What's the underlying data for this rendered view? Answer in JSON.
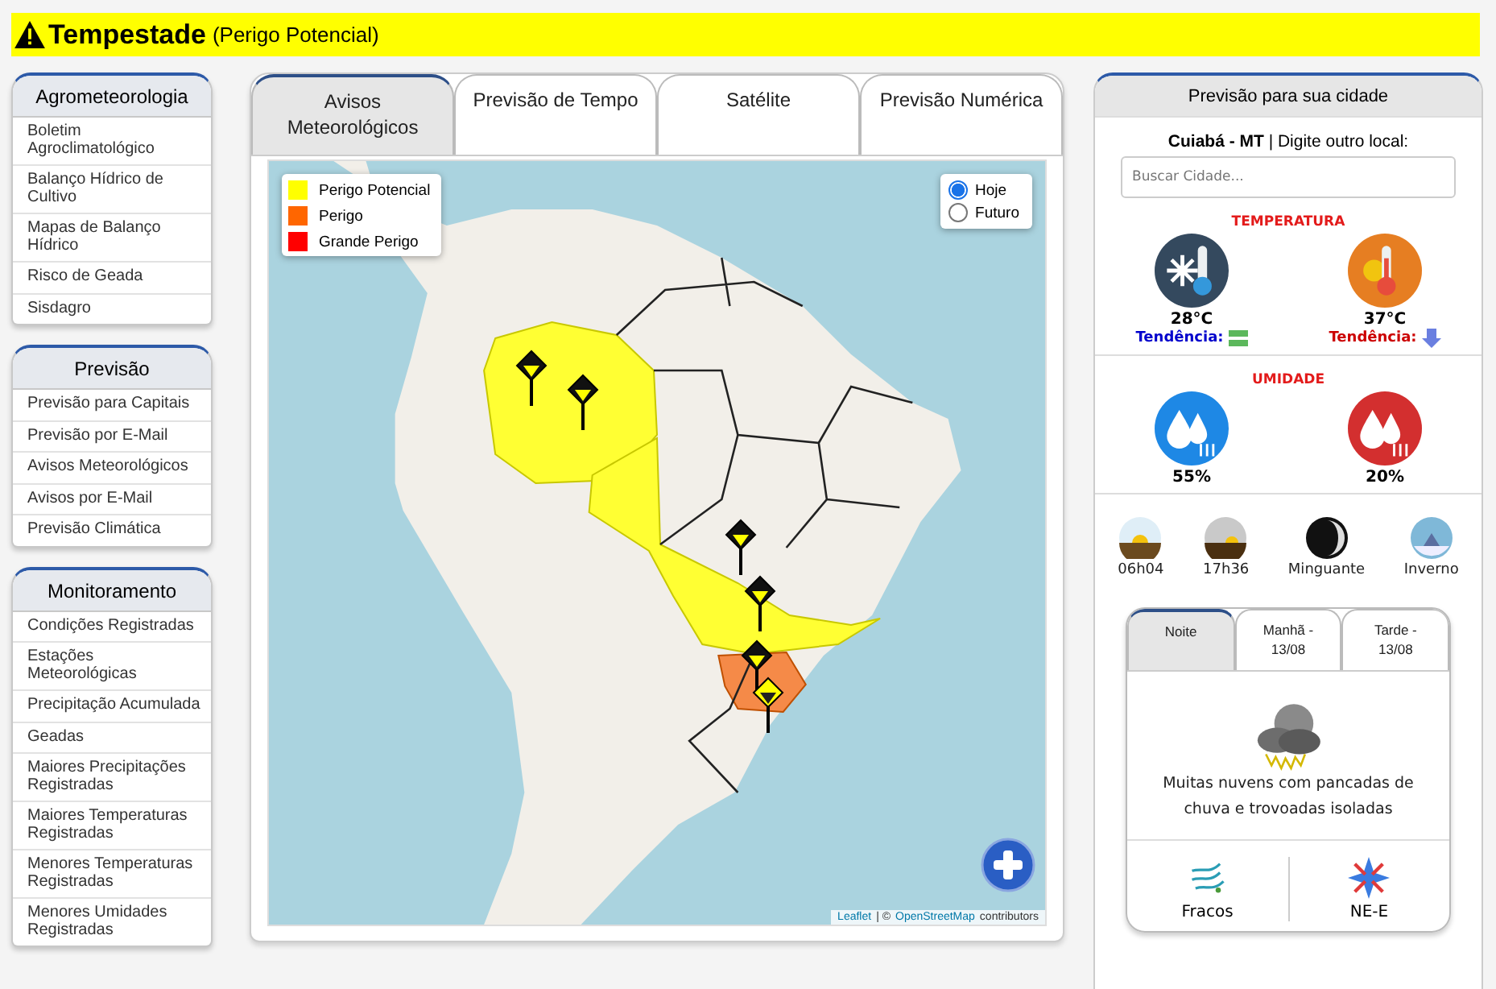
{
  "banner": {
    "title": "Tempestade",
    "subtitle": "(Perigo Potencial)"
  },
  "sidebar": [
    {
      "title": "Agrometeorologia",
      "items": [
        "Boletim Agroclimatológico",
        "Balanço Hídrico de Cultivo",
        "Mapas de Balanço Hídrico",
        "Risco de Geada",
        "Sisdagro"
      ]
    },
    {
      "title": "Previsão",
      "items": [
        "Previsão para Capitais",
        "Previsão por E-Mail",
        "Avisos Meteorológicos",
        "Avisos por E-Mail",
        "Previsão Climática"
      ]
    },
    {
      "title": "Monitoramento",
      "items": [
        "Condições Registradas",
        "Estações Meteorológicas",
        "Precipitação Acumulada",
        "Geadas",
        "Maiores Precipitações Registradas",
        "Maiores Temperaturas Registradas",
        "Menores Temperaturas Registradas",
        "Menores Umidades Registradas"
      ]
    }
  ],
  "tabs": [
    {
      "label": "Avisos Meteorológicos",
      "selected": true
    },
    {
      "label": "Previsão de Tempo",
      "selected": false
    },
    {
      "label": "Satélite",
      "selected": false
    },
    {
      "label": "Previsão Numérica",
      "selected": false
    }
  ],
  "map": {
    "legend": [
      {
        "label": "Perigo Potencial",
        "color": "#ffff00"
      },
      {
        "label": "Perigo",
        "color": "#ff6600"
      },
      {
        "label": "Grande Perigo",
        "color": "#ff0000"
      }
    ],
    "period_options": [
      {
        "label": "Hoje",
        "selected": true
      },
      {
        "label": "Futuro",
        "selected": false
      }
    ],
    "attribution": {
      "link_1": "Leaflet",
      "middle": "| ©",
      "link_2": "OpenStreetMap",
      "end": "contributors"
    }
  },
  "city_panel": {
    "title": "Previsão para sua cidade",
    "location": "**Cuiabá - MT** | Digite outro local:",
    "search": {
      "placeholder": "Buscar Cidade..."
    },
    "temperature": {
      "heading": "TEMPERATURA",
      "readings": [
        {
          "kind": "min",
          "value": "28°C",
          "trend_label": "Tendência:",
          "trend_icon": {
            "kind": "steady"
          },
          "color": "#0000cc"
        },
        {
          "kind": "max",
          "value": "37°C",
          "trend_label": "Tendência:",
          "trend_icon": {
            "kind": "down"
          },
          "color": "#cc0000"
        }
      ]
    },
    "humidity": {
      "heading": "UMIDADE",
      "readings": [
        {
          "kind": "max",
          "value": "55%"
        },
        {
          "kind": "min",
          "value": "20%"
        }
      ]
    },
    "astro": [
      {
        "kind": "sunrise",
        "label": "06h04"
      },
      {
        "kind": "sunset",
        "label": "17h36"
      },
      {
        "kind": "moon",
        "label": "Minguante"
      },
      {
        "kind": "season",
        "label": "Inverno"
      }
    ],
    "periods": [
      {
        "label": "Noite",
        "selected": true
      },
      {
        "label": "Manhã - 13/08",
        "selected": false
      },
      {
        "label": "Tarde - 13/08",
        "selected": false
      }
    ],
    "description": "Muitas nuvens com pancadas de chuva e trovoadas isoladas",
    "wind": {
      "strength": "Fracos",
      "direction": "NE-E"
    }
  }
}
